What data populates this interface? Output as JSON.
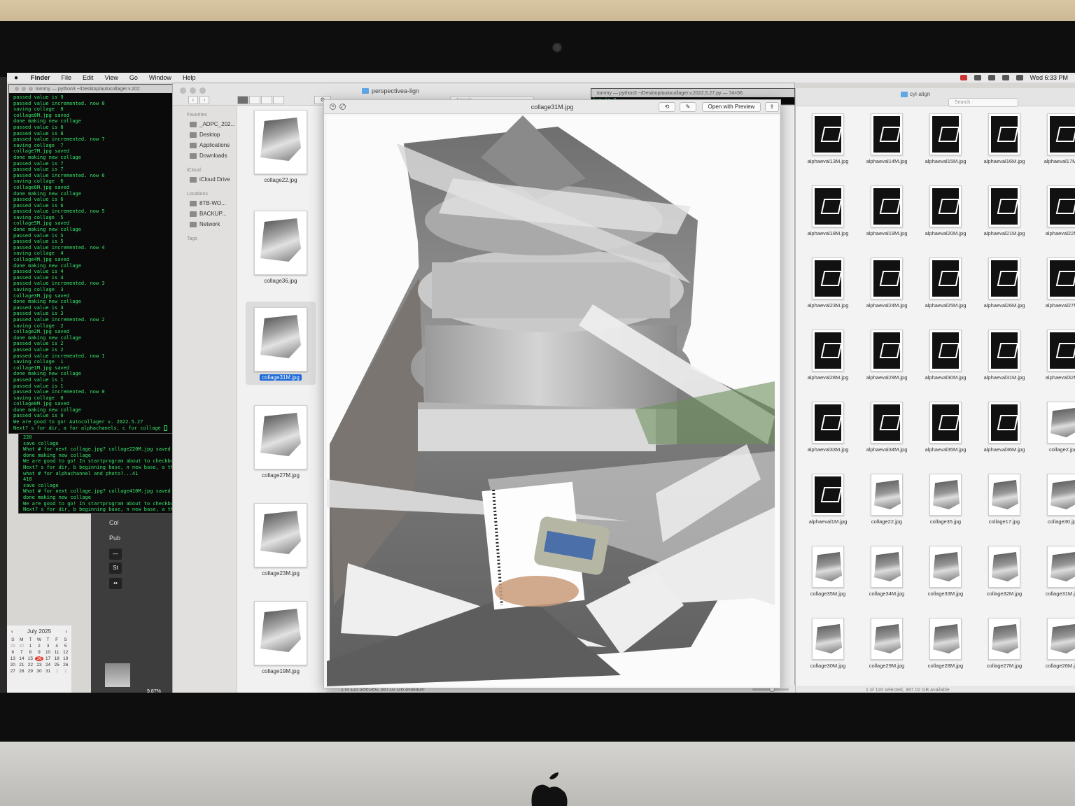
{
  "menubar": {
    "app": "Finder",
    "items": [
      "File",
      "Edit",
      "View",
      "Go",
      "Window",
      "Help"
    ],
    "clock": "Wed 6:33 PM"
  },
  "terminal_main": {
    "title": "tommy — python3 ~/Desktop/autocollager.v.202",
    "lines": [
      "passed value is 9",
      "passed value incremented. now 8",
      "saving collage  8",
      "collage8M.jpg saved",
      "done making new collage",
      "passed value is 8",
      "passed value is 8",
      "passed value incremented. now 7",
      "saving collage  7",
      "collage7M.jpg saved",
      "done making new collage",
      "passed value is 7",
      "passed value is 7",
      "passed value incremented. now 6",
      "saving collage  6",
      "collage6M.jpg saved",
      "done making new collage",
      "passed value is 6",
      "passed value is 6",
      "passed value incremented. now 5",
      "saving collage  5",
      "collage5M.jpg saved",
      "done making new collage",
      "passed value is 5",
      "passed value is 5",
      "passed value incremented. now 4",
      "saving collage  4",
      "collage4M.jpg saved",
      "done making new collage",
      "passed value is 4",
      "passed value is 4",
      "passed value incremented. now 3",
      "saving collage  3",
      "collage3M.jpg saved",
      "done making new collage",
      "passed value is 3",
      "passed value is 3",
      "passed value incremented. now 2",
      "saving collage  2",
      "collage2M.jpg saved",
      "done making new collage",
      "passed value is 2",
      "passed value is 2",
      "passed value incremented. now 1",
      "saving collage  1",
      "collage1M.jpg saved",
      "done making new collage",
      "passed value is 1",
      "passed value is 1",
      "passed value incremented. now 0",
      "saving collage  0",
      "collage0M.jpg saved",
      "done making new collage",
      "passed value is 0",
      "We are good to go! Autocollager v. 2022.5.27",
      "Next? s for dir, a for alphachanels, c for collage "
    ]
  },
  "terminal_back": {
    "lines": [
      "220",
      "save collage",
      "What # for next collage.jpg? collage220M.jpg saved",
      "done making new collage",
      "We are good to go! In startprogram about to checkbu",
      "Next? s for dir, b beginning base, n new base, a th",
      "what # for alphachannel and photo?...41",
      "410",
      "save collage",
      "What # for next collage.jpg? collage410M.jpg saved",
      "done making new collage",
      "We are good to go! In startprogram about to checkbu",
      "Next? s for dir, b beginning base, n new base, a th"
    ]
  },
  "terminal_right": {
    "title": "tommy — python3 ~/Desktop/autocollager.v.2022.5.27.py — 74×56",
    "line": "lue is 9"
  },
  "dark_app": {
    "rows": [
      "Col",
      "Pub"
    ],
    "status": "9.87%"
  },
  "calendar": {
    "month": "July 2025",
    "weekdays": [
      "S",
      "M",
      "T",
      "W",
      "T",
      "F",
      "S"
    ],
    "days": [
      "29",
      "30",
      "1",
      "2",
      "3",
      "4",
      "5",
      "6",
      "7",
      "8",
      "9",
      "10",
      "11",
      "12",
      "13",
      "14",
      "15",
      "16",
      "17",
      "18",
      "19",
      "20",
      "21",
      "22",
      "23",
      "24",
      "25",
      "26",
      "27",
      "28",
      "29",
      "30",
      "31",
      "1",
      "2"
    ],
    "today": "16"
  },
  "finder": {
    "window_title": "perspectivea-lign",
    "search_placeholder": "Search",
    "sidebar": {
      "favorites_header": "Favorites",
      "favorites": [
        "_ADPC_202...",
        "Desktop",
        "Applications",
        "Downloads"
      ],
      "icloud_header": "iCloud",
      "icloud": [
        "iCloud Drive"
      ],
      "locations_header": "Locations",
      "locations": [
        "8TB-WO...",
        "BACKUP...",
        "Network"
      ],
      "tags_header": "Tags"
    },
    "files": [
      "collage22.jpg",
      "collage36.jpg",
      "collage31M.jpg",
      "collage27M.jpg",
      "collage23M.jpg",
      "collage19M.jpg"
    ],
    "selected_file": "collage31M.jpg",
    "status": "1 of 116 selected, 387.02 GB available"
  },
  "quicklook": {
    "title": "collage31M.jpg",
    "open_with": "Open with Preview"
  },
  "finder_right": {
    "window_title": "cyl-align",
    "search_placeholder": "Search",
    "tiles": [
      {
        "name": "alphaeval13M.jpg",
        "kind": "black"
      },
      {
        "name": "alphaeval14M.jpg",
        "kind": "black"
      },
      {
        "name": "alphaeval15M.jpg",
        "kind": "black"
      },
      {
        "name": "alphaeval16M.jpg",
        "kind": "black"
      },
      {
        "name": "alphaeval17M.jp",
        "kind": "black"
      },
      {
        "name": "alphaeval18M.jpg",
        "kind": "black"
      },
      {
        "name": "alphaeval19M.jpg",
        "kind": "black"
      },
      {
        "name": "alphaeval20M.jpg",
        "kind": "black"
      },
      {
        "name": "alphaeval21M.jpg",
        "kind": "black"
      },
      {
        "name": "alphaeval22M.j",
        "kind": "black"
      },
      {
        "name": "alphaeval23M.jpg",
        "kind": "black"
      },
      {
        "name": "alphaeval24M.jpg",
        "kind": "black"
      },
      {
        "name": "alphaeval25M.jpg",
        "kind": "black"
      },
      {
        "name": "alphaeval26M.jpg",
        "kind": "black"
      },
      {
        "name": "alphaeval27M.j",
        "kind": "black"
      },
      {
        "name": "alphaeval28M.jpg",
        "kind": "black"
      },
      {
        "name": "alphaeval29M.jpg",
        "kind": "black"
      },
      {
        "name": "alphaeval30M.jpg",
        "kind": "black"
      },
      {
        "name": "alphaeval31M.jpg",
        "kind": "black"
      },
      {
        "name": "alphaeval32M.j",
        "kind": "black"
      },
      {
        "name": "alphaeval33M.jpg",
        "kind": "black"
      },
      {
        "name": "alphaeval34M.jpg",
        "kind": "black"
      },
      {
        "name": "alphaeval35M.jpg",
        "kind": "black"
      },
      {
        "name": "alphaeval36M.jpg",
        "kind": "black"
      },
      {
        "name": "collage2.jpg",
        "kind": "photo"
      },
      {
        "name": "alphaeval1M.jpg",
        "kind": "black"
      },
      {
        "name": "collage22.jpg",
        "kind": "photo"
      },
      {
        "name": "collage35.jpg",
        "kind": "photo"
      },
      {
        "name": "collage17.jpg",
        "kind": "photo"
      },
      {
        "name": "collage30.jpg",
        "kind": "photo"
      },
      {
        "name": "collage35M.jpg",
        "kind": "photo"
      },
      {
        "name": "collage34M.jpg",
        "kind": "photo"
      },
      {
        "name": "collage33M.jpg",
        "kind": "photo"
      },
      {
        "name": "collage32M.jpg",
        "kind": "photo"
      },
      {
        "name": "collage31M.jpg",
        "kind": "photo"
      },
      {
        "name": "collage30M.jpg",
        "kind": "photo"
      },
      {
        "name": "collage29M.jpg",
        "kind": "photo"
      },
      {
        "name": "collage28M.jpg",
        "kind": "photo"
      },
      {
        "name": "collage27M.jpg",
        "kind": "photo"
      },
      {
        "name": "collage26M.jpg",
        "kind": "photo"
      }
    ],
    "status": "1 of 116 selected, 387.02 GB available"
  }
}
